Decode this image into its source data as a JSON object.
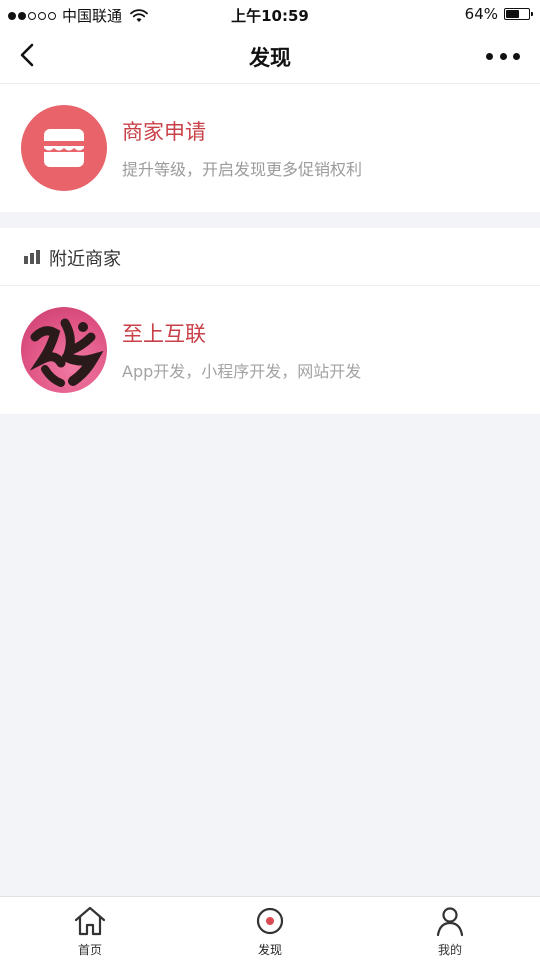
{
  "status_bar": {
    "carrier": "中国联通",
    "time": "上午10:59",
    "battery": "64%",
    "battery_level": 0.64,
    "signal_bars_filled": 2,
    "signal_bars_total": 5
  },
  "nav": {
    "title": "发现",
    "back_icon": "chevron-left-icon",
    "more_icon": "more-dots-icon"
  },
  "apply_card": {
    "title": "商家申请",
    "subtitle": "提升等级，开启发现更多促销权利",
    "icon": "store-icon",
    "accent_color": "#e8646a"
  },
  "nearby": {
    "section_title": "附近商家",
    "icon": "bar-chart-icon",
    "merchants": [
      {
        "name": "至上互联",
        "description": "App开发，小程序开发，网站开发",
        "avatar": "calligraphy-avatar"
      }
    ]
  },
  "tab_bar": {
    "tabs": [
      {
        "label": "首页",
        "icon": "home-icon"
      },
      {
        "label": "发现",
        "icon": "discover-icon"
      },
      {
        "label": "我的",
        "icon": "user-icon"
      }
    ],
    "active_index": 1
  },
  "colors": {
    "title_red": "#c94148",
    "background": "#f3f4f8"
  }
}
